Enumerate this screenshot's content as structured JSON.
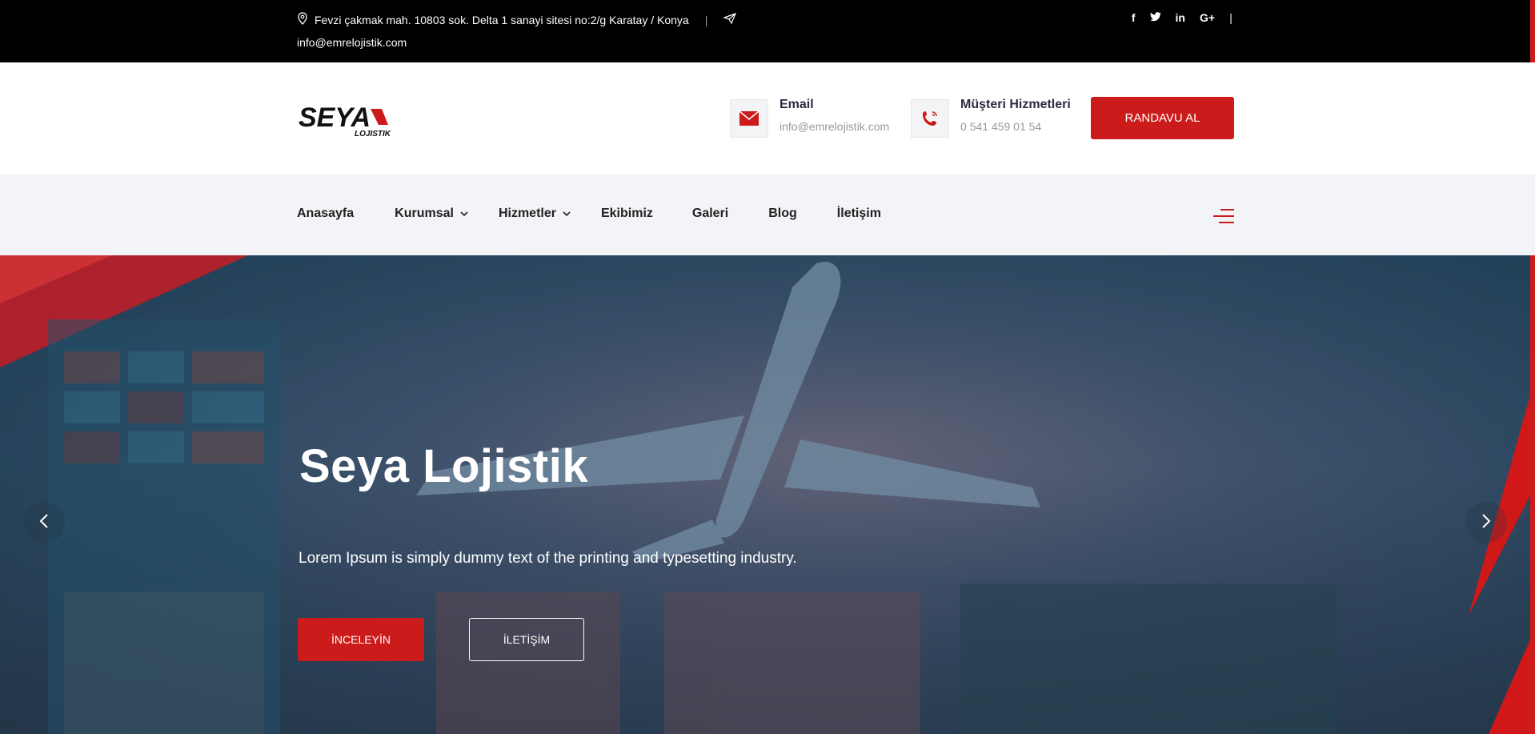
{
  "topbar": {
    "address": "Fevzi çakmak mah. 10803 sok. Delta 1 sanayi sitesi no:2/g Karatay / Konya",
    "separator": "|",
    "email": "info@emrelojistik.com",
    "social": [
      "f",
      "t",
      "in",
      "G+"
    ],
    "social_separator": "|"
  },
  "header": {
    "logo_text": "SEYA",
    "logo_sub": "LOJISTIK",
    "email_title": "Email",
    "email_value": "info@emrelojistik.com",
    "phone_title": "Müşteri Hizmetleri",
    "phone_value": "0 541 459 01 54",
    "cta_label": "RANDAVU AL"
  },
  "nav": {
    "items": [
      {
        "label": "Anasayfa"
      },
      {
        "label": "Kurumsal"
      },
      {
        "label": "Hizmetler"
      },
      {
        "label": "Ekibimiz"
      },
      {
        "label": "Galeri"
      },
      {
        "label": "Blog"
      },
      {
        "label": "İletişim"
      }
    ]
  },
  "hero": {
    "title": "Seya Lojistik",
    "subtitle": "Lorem Ipsum is simply dummy text of the printing and typesetting industry.",
    "primary_button": "İNCELEYİN",
    "secondary_button": "İLETİŞİM"
  },
  "colors": {
    "brand_red": "#cc1b1b",
    "topbar_bg": "#000000",
    "nav_bg": "#f3f4f7"
  },
  "icons": {
    "address": "map-pin-icon",
    "send": "paper-plane-icon",
    "email": "envelope-icon",
    "phone": "phone-icon",
    "menu": "hamburger-icon",
    "prev": "chevron-left-icon",
    "next": "chevron-right-icon"
  }
}
